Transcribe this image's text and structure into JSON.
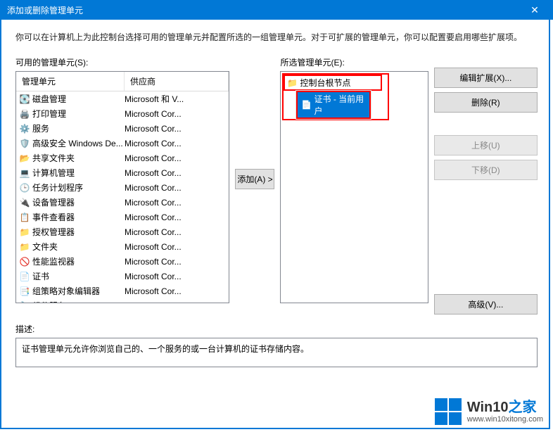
{
  "titlebar": {
    "title": "添加或删除管理单元"
  },
  "intro": "你可以在计算机上为此控制台选择可用的管理单元并配置所选的一组管理单元。对于可扩展的管理单元，你可以配置要启用哪些扩展项。",
  "left": {
    "label": "可用的管理单元(S):",
    "headers": {
      "name": "管理单元",
      "vendor": "供应商"
    },
    "items": [
      {
        "icon": "disk",
        "name": "磁盘管理",
        "vendor": "Microsoft 和 V..."
      },
      {
        "icon": "printer",
        "name": "打印管理",
        "vendor": "Microsoft Cor..."
      },
      {
        "icon": "gears",
        "name": "服务",
        "vendor": "Microsoft Cor..."
      },
      {
        "icon": "shield",
        "name": "高级安全 Windows De...",
        "vendor": "Microsoft Cor..."
      },
      {
        "icon": "folders",
        "name": "共享文件夹",
        "vendor": "Microsoft Cor..."
      },
      {
        "icon": "computer",
        "name": "计算机管理",
        "vendor": "Microsoft Cor..."
      },
      {
        "icon": "clock",
        "name": "任务计划程序",
        "vendor": "Microsoft Cor..."
      },
      {
        "icon": "device",
        "name": "设备管理器",
        "vendor": "Microsoft Cor..."
      },
      {
        "icon": "event",
        "name": "事件查看器",
        "vendor": "Microsoft Cor..."
      },
      {
        "icon": "folder",
        "name": "授权管理器",
        "vendor": "Microsoft Cor..."
      },
      {
        "icon": "folder",
        "name": "文件夹",
        "vendor": "Microsoft Cor..."
      },
      {
        "icon": "perf",
        "name": "性能监视器",
        "vendor": "Microsoft Cor..."
      },
      {
        "icon": "cert",
        "name": "证书",
        "vendor": "Microsoft Cor..."
      },
      {
        "icon": "policy",
        "name": "组策略对象编辑器",
        "vendor": "Microsoft Cor..."
      },
      {
        "icon": "component",
        "name": "组件服务",
        "vendor": "Microsoft Cor..."
      }
    ]
  },
  "add_button": "添加(A) >",
  "right": {
    "label": "所选管理单元(E):",
    "root": "控制台根节点",
    "selected": "证书 - 当前用户"
  },
  "buttons": {
    "edit_ext": "编辑扩展(X)...",
    "remove": "删除(R)",
    "move_up": "上移(U)",
    "move_down": "下移(D)",
    "advanced": "高级(V)..."
  },
  "desc": {
    "label": "描述:",
    "text": "证书管理单元允许你浏览自己的、一个服务的或一台计算机的证书存储内容。"
  },
  "watermark": {
    "brand_a": "Win10",
    "brand_b": "之家",
    "url": "www.win10xitong.com"
  }
}
